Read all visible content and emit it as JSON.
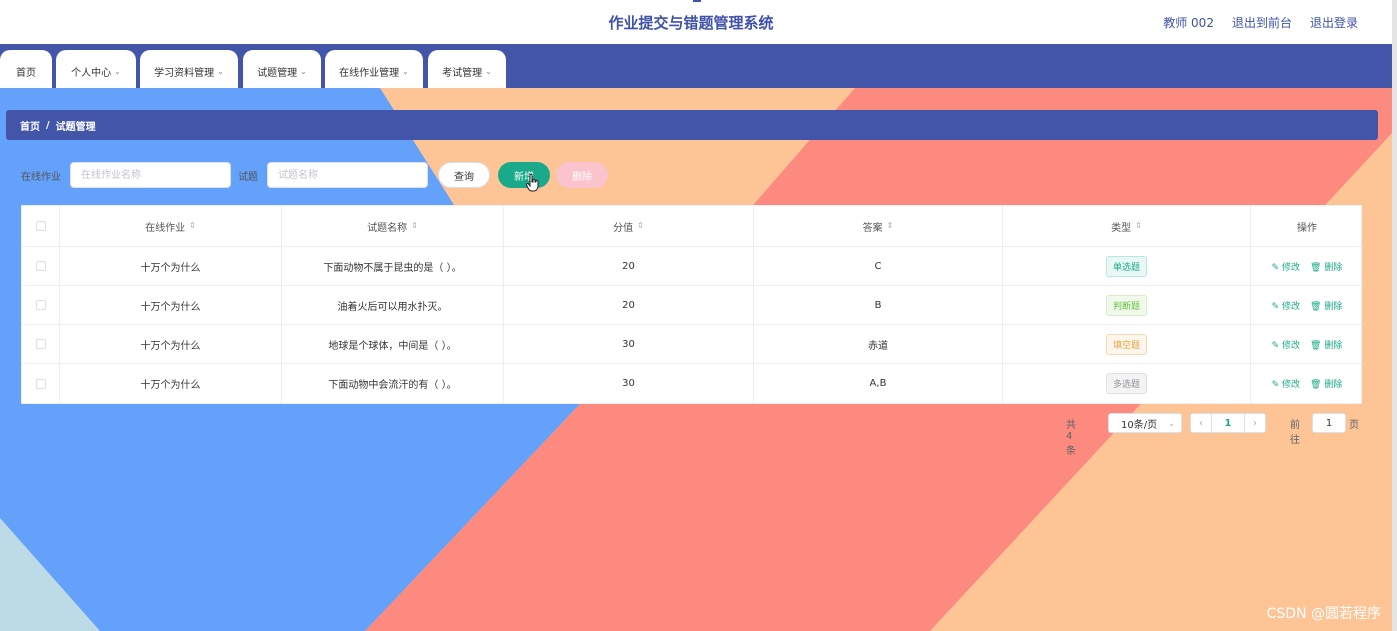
{
  "header": {
    "title": "作业提交与错题管理系统",
    "user": "教师 002",
    "to_front": "退出到前台",
    "logout": "退出登录"
  },
  "nav": {
    "tabs": [
      {
        "label": "首页",
        "dropdown": false
      },
      {
        "label": "个人中心",
        "dropdown": true
      },
      {
        "label": "学习资料管理",
        "dropdown": true
      },
      {
        "label": "试题管理",
        "dropdown": true
      },
      {
        "label": "在线作业管理",
        "dropdown": true
      },
      {
        "label": "考试管理",
        "dropdown": true
      }
    ]
  },
  "breadcrumb": {
    "home": "首页",
    "sep": "/",
    "current": "试题管理"
  },
  "search": {
    "homework_label": "在线作业",
    "homework_placeholder": "在线作业名称",
    "question_label": "试题",
    "question_placeholder": "试题名称",
    "query": "查询",
    "add": "新增",
    "delete": "删除"
  },
  "table": {
    "headers": {
      "homework": "在线作业",
      "name": "试题名称",
      "score": "分值",
      "answer": "答案",
      "type": "类型",
      "ops": "操作"
    },
    "rows": [
      {
        "homework": "十万个为什么",
        "name": "下面动物不属于昆虫的是（ ）。",
        "score": "20",
        "answer": "C",
        "type": "单选题"
      },
      {
        "homework": "十万个为什么",
        "name": "油着火后可以用水扑灭。",
        "score": "20",
        "answer": "B",
        "type": "判断题"
      },
      {
        "homework": "十万个为什么",
        "name": "地球是个球体，中间是（ ）。",
        "score": "30",
        "answer": "赤道",
        "type": "填空题"
      },
      {
        "homework": "十万个为什么",
        "name": "下面动物中会流汗的有（ ）。",
        "score": "30",
        "answer": "A,B",
        "type": "多选题"
      }
    ],
    "edit": "修改",
    "remove": "删除"
  },
  "pagination": {
    "total": "共 4 条",
    "page_size": "10条/页",
    "current_page": "1",
    "goto_label": "前往",
    "goto_value": "1",
    "page_unit": "页"
  },
  "watermark": "CSDN @圆若程序",
  "colors": {
    "primary": "#4255a8",
    "accent": "#1aaa8a",
    "bg_blue": "#64a1fb",
    "bg_salmon": "#fd8a7e",
    "bg_peach": "#fdc496"
  }
}
